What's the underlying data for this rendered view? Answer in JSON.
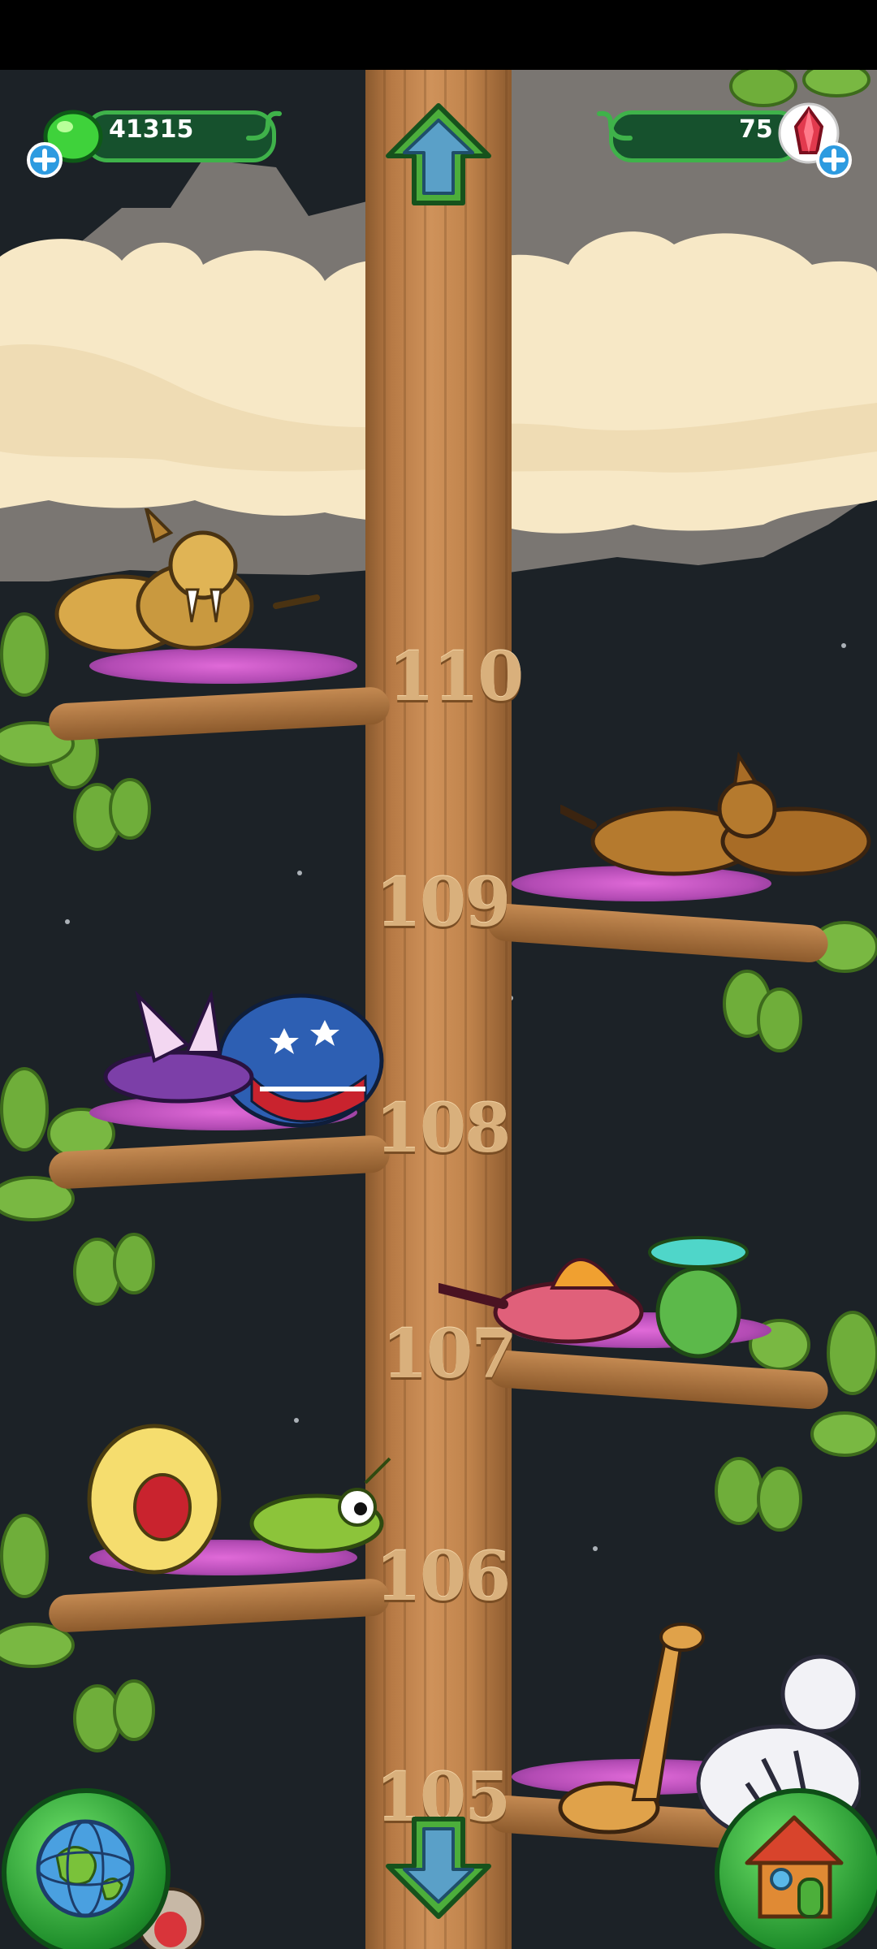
{
  "hud": {
    "coins_value": "41315",
    "gems_value": "75",
    "coin_icon": "green-slime-icon",
    "gem_icon": "red-crystal-icon",
    "add_icon": "plus-icon"
  },
  "tree": {
    "levels": [
      "110",
      "109",
      "108",
      "107",
      "106",
      "105"
    ]
  },
  "navigation": {
    "up_icon": "arrow-up-icon",
    "down_icon": "arrow-down-icon",
    "map_icon": "globe-icon",
    "home_icon": "house-icon"
  },
  "colors": {
    "sky": "#1c2227",
    "trunk": "#c1844c",
    "leaves": "#6fae3a",
    "nest": "#b34bb4",
    "hud_green": "#3fb24a"
  }
}
